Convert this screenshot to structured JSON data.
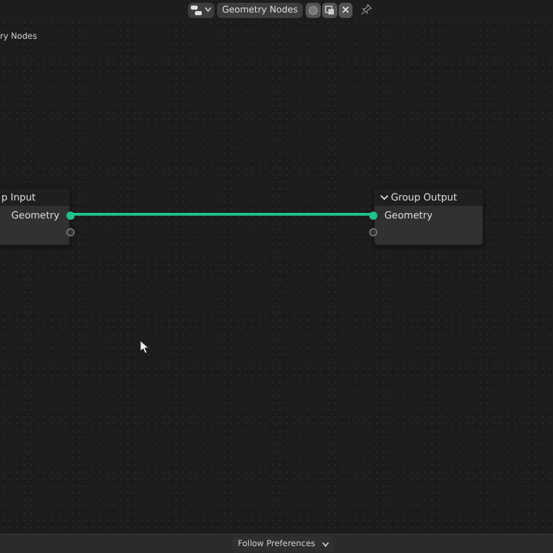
{
  "header": {
    "node_tree_name": "Geometry Nodes"
  },
  "breadcrumb": "ry Nodes",
  "nodes": [
    {
      "kind": "input",
      "title": "p Input",
      "toggle_visible": false,
      "sockets": [
        {
          "label": "Geometry",
          "connected": true
        },
        {
          "connected": false
        }
      ]
    },
    {
      "kind": "output",
      "title": "Group Output",
      "toggle_visible": true,
      "sockets": [
        {
          "label": "Geometry",
          "connected": true
        },
        {
          "connected": false
        }
      ]
    }
  ],
  "footer": {
    "dropdown": "Follow Preferences"
  }
}
